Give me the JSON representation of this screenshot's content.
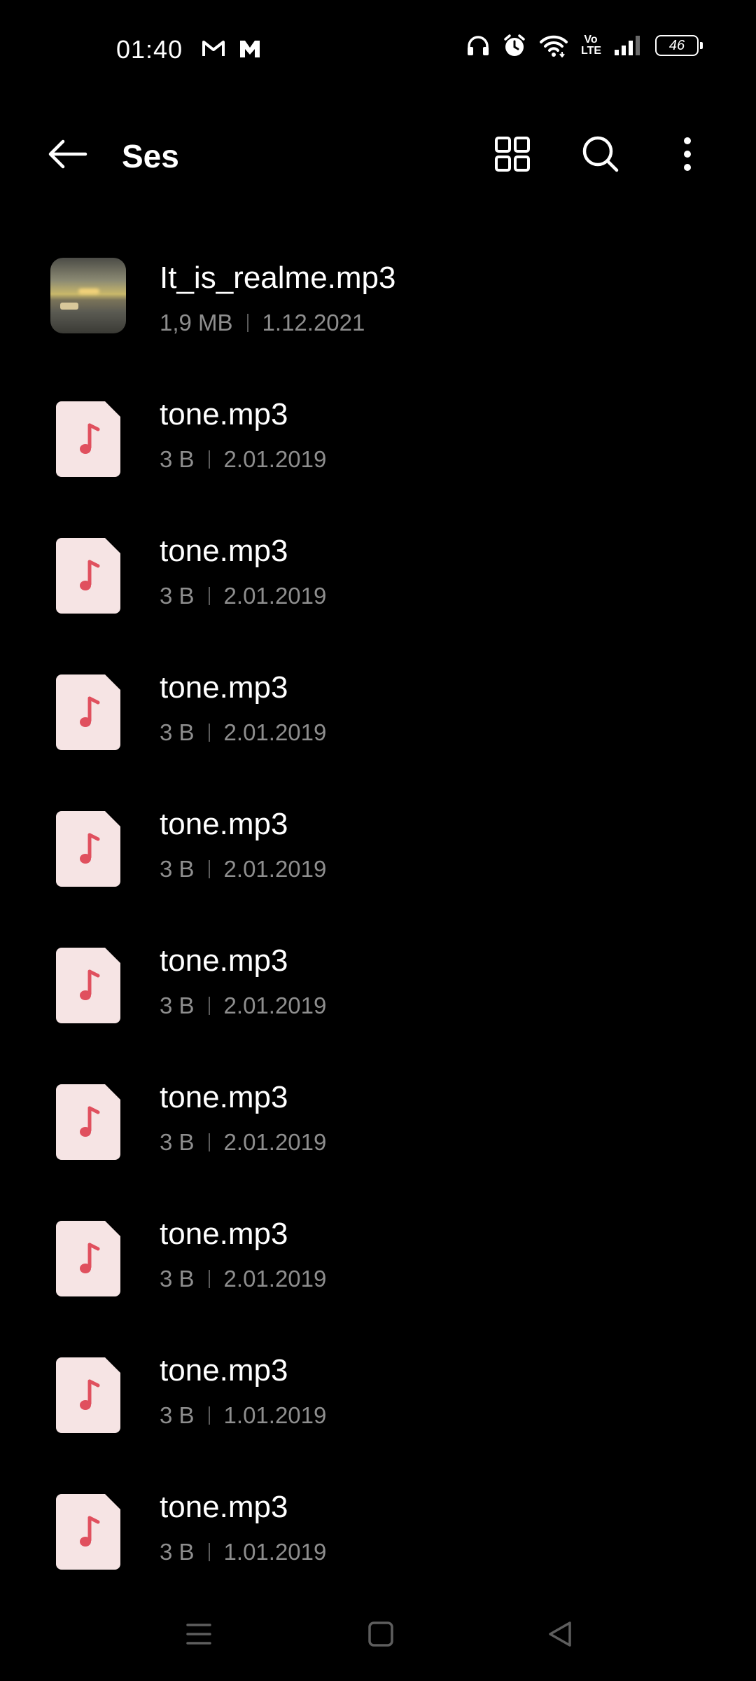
{
  "status_bar": {
    "time": "01:40",
    "battery": "46",
    "volte_top": "Vo",
    "volte_bottom": "LTE"
  },
  "app_bar": {
    "title": "Ses"
  },
  "colors": {
    "background": "#000000",
    "text_primary": "#ffffff",
    "text_secondary": "#8e8e8e",
    "audio_icon_bg": "#f6e4e4",
    "audio_icon_note": "#e0505e"
  },
  "files": [
    {
      "name": "It_is_realme.mp3",
      "size": "1,9 MB",
      "date": "1.12.2021",
      "icon": "image-thumbnail"
    },
    {
      "name": "tone.mp3",
      "size": "3 B",
      "date": "2.01.2019",
      "icon": "music-note-file-icon"
    },
    {
      "name": "tone.mp3",
      "size": "3 B",
      "date": "2.01.2019",
      "icon": "music-note-file-icon"
    },
    {
      "name": "tone.mp3",
      "size": "3 B",
      "date": "2.01.2019",
      "icon": "music-note-file-icon"
    },
    {
      "name": "tone.mp3",
      "size": "3 B",
      "date": "2.01.2019",
      "icon": "music-note-file-icon"
    },
    {
      "name": "tone.mp3",
      "size": "3 B",
      "date": "2.01.2019",
      "icon": "music-note-file-icon"
    },
    {
      "name": "tone.mp3",
      "size": "3 B",
      "date": "2.01.2019",
      "icon": "music-note-file-icon"
    },
    {
      "name": "tone.mp3",
      "size": "3 B",
      "date": "2.01.2019",
      "icon": "music-note-file-icon"
    },
    {
      "name": "tone.mp3",
      "size": "3 B",
      "date": "1.01.2019",
      "icon": "music-note-file-icon"
    },
    {
      "name": "tone.mp3",
      "size": "3 B",
      "date": "1.01.2019",
      "icon": "music-note-file-icon"
    }
  ]
}
